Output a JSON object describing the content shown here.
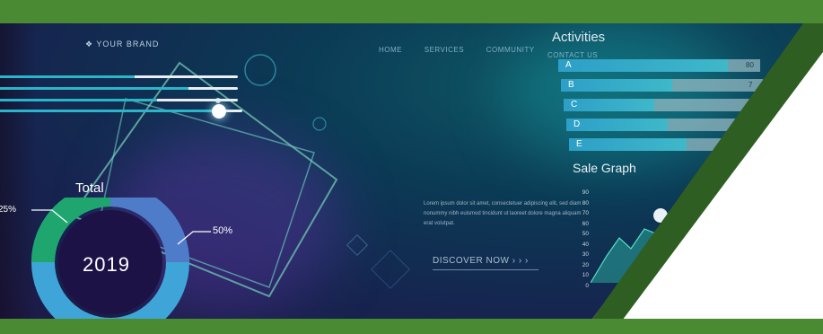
{
  "brand": "YOUR BRAND",
  "nav": [
    "HOME",
    "SERVICES",
    "COMMUNITY",
    "CONTACT US"
  ],
  "activities": {
    "title": "Activities",
    "items": [
      {
        "label": "A",
        "value": "80",
        "fill": 0.84
      },
      {
        "label": "B",
        "value": "7",
        "fill": 0.55
      },
      {
        "label": "C",
        "value": "",
        "fill": 0.45
      },
      {
        "label": "D",
        "value": "",
        "fill": 0.5
      },
      {
        "label": "E",
        "value": "",
        "fill": 0.58
      }
    ]
  },
  "sale_graph": {
    "title": "Sale Graph",
    "y_ticks": [
      "90",
      "80",
      "70",
      "60",
      "50",
      "40",
      "30",
      "20",
      "10",
      "0"
    ]
  },
  "donut": {
    "title": "Total",
    "label_left": "25%",
    "label_right": "50%",
    "year": "2019"
  },
  "lorem": "Lorem ipsum dolor sit amet, consectetuer adipiscing elit, sed diam nonummy nibh euismod tincidunt ut laoreet dolore magna aliquam erat volutpat.",
  "cta": "DISCOVER NOW  › › ›",
  "colors": {
    "frame_green": "#4a8a32",
    "dark_green": "#2f5e23",
    "teal": "#2bb5c9",
    "navy": "#16244f"
  }
}
